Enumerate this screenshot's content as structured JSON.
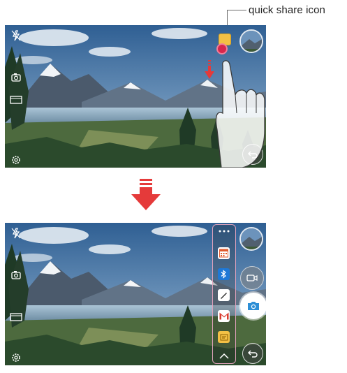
{
  "callout": {
    "label": "quick share icon"
  },
  "screens": {
    "top": {
      "name": "camera-before"
    },
    "bottom": {
      "name": "camera-after"
    }
  },
  "icons": {
    "flash": "flash-off-icon",
    "mode": "mode-icon",
    "ratio": "ratio-icon",
    "settings": "settings-gear-icon",
    "gallery": "gallery-thumbnail",
    "back": "back-icon",
    "video": "video-record-icon",
    "shutter": "camera-shutter-icon",
    "quick_share": "quick-share-icon"
  },
  "share_apps": [
    "more",
    "calendar",
    "bluetooth",
    "memo",
    "gmail",
    "messaging",
    "collapse"
  ],
  "colors": {
    "callout_line": "#6b6b6b",
    "share_outline": "#e2a2bc",
    "arrow_red": "#e53a3a",
    "share_icon": "#f3c045"
  }
}
